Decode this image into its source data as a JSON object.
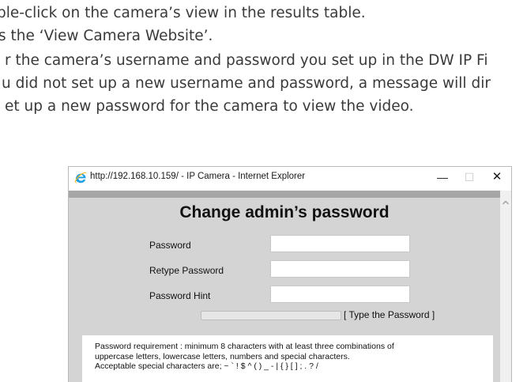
{
  "document": {
    "lines": [
      "ble-click on the camera’s view in the results table.",
      "s the ‘View Camera Website’.",
      "r the camera’s username and password you set up in the DW IP Fi",
      "u did not set up a new username and password, a message will dir",
      "et up a new password for the camera to view the video."
    ]
  },
  "window": {
    "title": "http://192.168.10.159/ - IP Camera - Internet Explorer",
    "minimize": "—",
    "maximize": "☐",
    "close": "✕",
    "icon": "internet-explorer-icon"
  },
  "form": {
    "heading": "Change admin’s password",
    "fields": [
      {
        "label": "Password",
        "value": ""
      },
      {
        "label": "Retype Password",
        "value": ""
      },
      {
        "label": "Password Hint",
        "value": ""
      }
    ],
    "strength_text": "[ Type the Password ]",
    "strength_level": 0
  },
  "requirements": {
    "lines": [
      "Password requirement : minimum 8 characters with at least three combinations of",
      "uppercase letters, lowercase letters, numbers and special characters.",
      "Acceptable special characters are; ~ ` ! $ ^ ( ) _ - | { } [ ] ; . ? /"
    ]
  },
  "colors": {
    "page_bg": "#d4d4d4",
    "strip": "#a6a6a6",
    "text": "#3a3a3a",
    "ie_blue": "#1b9ee4",
    "ie_gold": "#f4b71c"
  }
}
